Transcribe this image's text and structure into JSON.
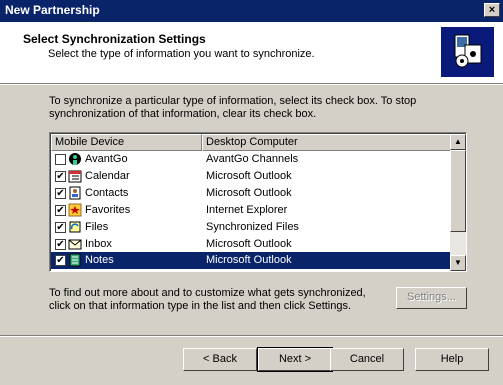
{
  "window": {
    "title": "New Partnership",
    "close_glyph": "×"
  },
  "header": {
    "title": "Select Synchronization Settings",
    "subtitle": "Select the type of information you want to synchronize.",
    "icon": "sync-devices-icon"
  },
  "intro_text": "To synchronize a particular type of information, select its check box. To stop synchronization of that information, clear its check box.",
  "list": {
    "columns": [
      "Mobile Device",
      "Desktop Computer"
    ],
    "rows": [
      {
        "device": "AvantGo",
        "desktop": "AvantGo Channels",
        "checked": false,
        "icon": "avantgo-icon",
        "selected": false
      },
      {
        "device": "Calendar",
        "desktop": "Microsoft Outlook",
        "checked": true,
        "icon": "calendar-icon",
        "selected": false
      },
      {
        "device": "Contacts",
        "desktop": "Microsoft Outlook",
        "checked": true,
        "icon": "contacts-icon",
        "selected": false
      },
      {
        "device": "Favorites",
        "desktop": "Internet Explorer",
        "checked": true,
        "icon": "favorites-icon",
        "selected": false
      },
      {
        "device": "Files",
        "desktop": "Synchronized Files",
        "checked": true,
        "icon": "files-icon",
        "selected": false
      },
      {
        "device": "Inbox",
        "desktop": "Microsoft Outlook",
        "checked": true,
        "icon": "inbox-icon",
        "selected": false
      },
      {
        "device": "Notes",
        "desktop": "Microsoft Outlook",
        "checked": true,
        "icon": "notes-icon",
        "selected": true
      }
    ],
    "checkmark_glyph": "✔"
  },
  "info_text": "To find out more about and to customize what gets synchronized, click on that information type in the list and then click Settings.",
  "buttons": {
    "settings": "Settings...",
    "back": "< Back",
    "next": "Next >",
    "cancel": "Cancel",
    "help": "Help"
  },
  "colors": {
    "titlebar": "#0a246a",
    "selection": "#0a246a",
    "face": "#d4d0c8"
  }
}
